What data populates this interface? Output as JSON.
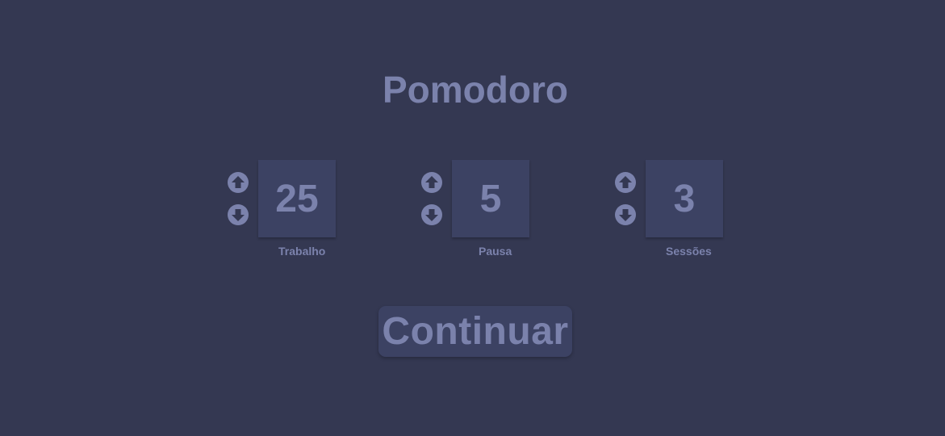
{
  "app": {
    "title": "Pomodoro"
  },
  "settings": [
    {
      "id": "trabalho",
      "value": "25",
      "label": "Trabalho",
      "up_icon": "arrow-up-circle-icon",
      "down_icon": "arrow-down-circle-icon"
    },
    {
      "id": "pausa",
      "value": "5",
      "label": "Pausa",
      "up_icon": "arrow-up-circle-icon",
      "down_icon": "arrow-down-circle-icon"
    },
    {
      "id": "sessoes",
      "value": "3",
      "label": "Sessões",
      "up_icon": "arrow-up-circle-icon",
      "down_icon": "arrow-down-circle-icon"
    }
  ],
  "actions": {
    "continue_label": "Continuar"
  },
  "colors": {
    "background": "#343852",
    "accent": "#7b82ac",
    "box": "#3c4263"
  }
}
